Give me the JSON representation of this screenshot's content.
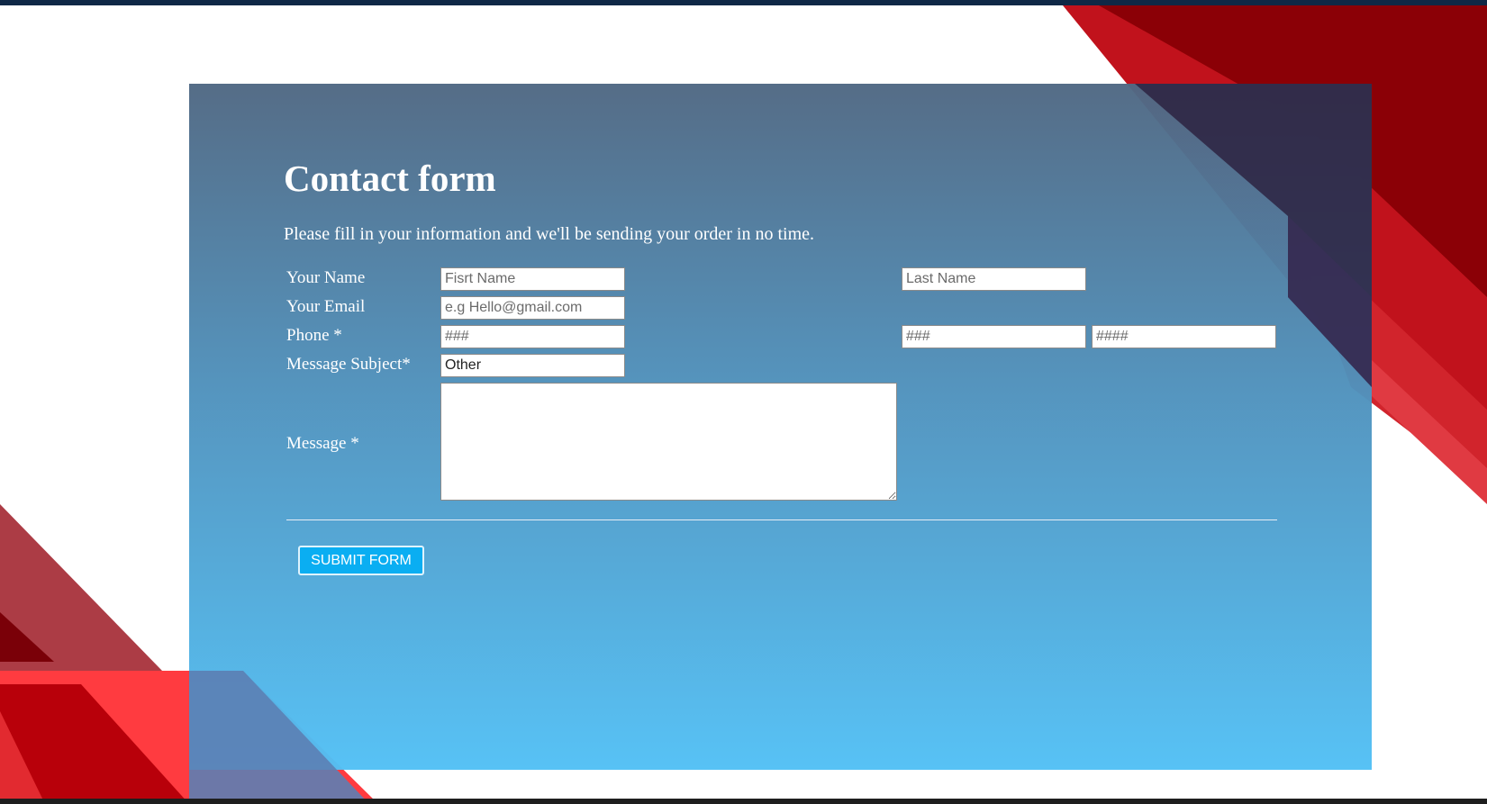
{
  "form": {
    "title": "Contact form",
    "intro": "Please fill in your information and we'll be sending your order in no time.",
    "labels": {
      "name": "Your Name",
      "email": "Your Email",
      "phone": "Phone *",
      "subject": "Message Subject*",
      "message": "Message *"
    },
    "inputs": {
      "first_name": {
        "placeholder": "Fisrt Name",
        "value": ""
      },
      "last_name": {
        "placeholder": "Last Name",
        "value": ""
      },
      "email": {
        "placeholder": "e.g Hello@gmail.com",
        "value": ""
      },
      "phone_area": {
        "placeholder": "###",
        "value": ""
      },
      "phone_prefix": {
        "placeholder": "###",
        "value": ""
      },
      "phone_line": {
        "placeholder": "####",
        "value": ""
      },
      "subject": {
        "placeholder": "",
        "value": "Other"
      },
      "message": {
        "value": ""
      }
    },
    "submit_label": "SUBMIT FORM"
  },
  "colors": {
    "panel_top": "#506883",
    "panel_bottom": "#52c0f5",
    "accent_red": "#c8101e",
    "dark_red": "#8b0000",
    "button_blue": "#0aaef2"
  }
}
